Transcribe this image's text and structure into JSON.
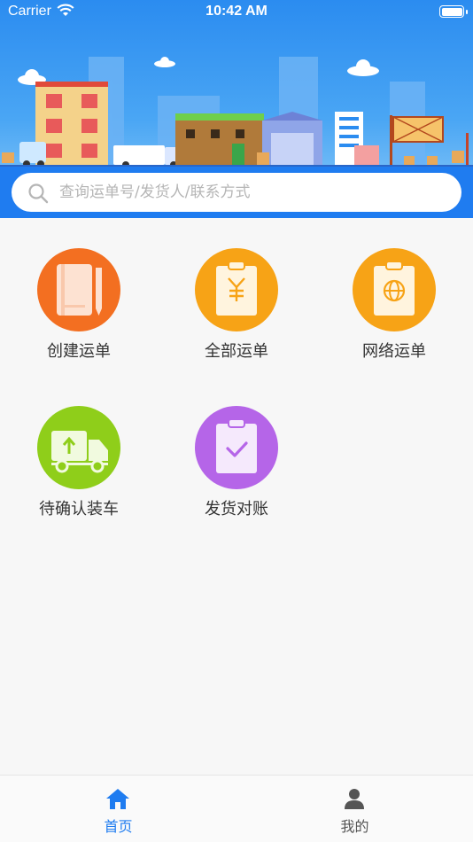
{
  "status_bar": {
    "carrier": "Carrier",
    "time": "10:42 AM"
  },
  "search": {
    "placeholder": "查询运单号/发货人/联系方式"
  },
  "menu": [
    {
      "label": "创建运单",
      "icon": "create-waybill-icon",
      "color": "#f36f21"
    },
    {
      "label": "全部运单",
      "icon": "all-waybills-icon",
      "color": "#f7a316"
    },
    {
      "label": "网络运单",
      "icon": "network-waybill-icon",
      "color": "#f7a316"
    },
    {
      "label": "待确认装车",
      "icon": "loading-truck-icon",
      "color": "#8fce1a"
    },
    {
      "label": "发货对账",
      "icon": "reconciliation-icon",
      "color": "#b565e8"
    }
  ],
  "tabbar": {
    "items": [
      {
        "label": "首页",
        "icon": "home-icon",
        "active": true
      },
      {
        "label": "我的",
        "icon": "user-icon",
        "active": false
      }
    ],
    "active_color": "#1f7cf0",
    "inactive_color": "#555555"
  }
}
